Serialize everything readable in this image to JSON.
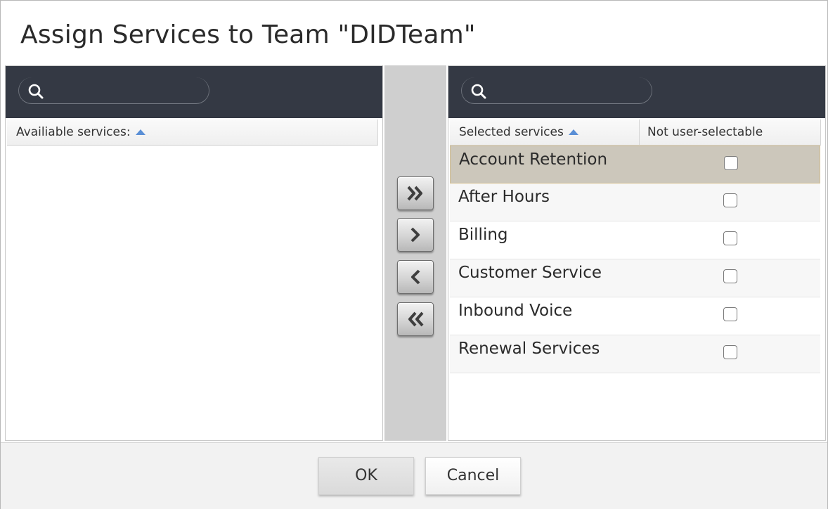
{
  "dialog": {
    "title": "Assign Services to Team \"DIDTeam\""
  },
  "available": {
    "search_placeholder": "",
    "column_header": "Availiable services:",
    "items": []
  },
  "selected": {
    "search_placeholder": "",
    "column_header": "Selected services",
    "column_header_2": "Not user-selectable",
    "items": [
      {
        "label": "Account Retention",
        "not_user_selectable": false,
        "highlighted": true
      },
      {
        "label": "After Hours",
        "not_user_selectable": false,
        "highlighted": false
      },
      {
        "label": "Billing",
        "not_user_selectable": false,
        "highlighted": false
      },
      {
        "label": "Customer Service",
        "not_user_selectable": false,
        "highlighted": false
      },
      {
        "label": "Inbound Voice",
        "not_user_selectable": false,
        "highlighted": false
      },
      {
        "label": "Renewal Services",
        "not_user_selectable": false,
        "highlighted": false
      }
    ]
  },
  "transfer_buttons": [
    {
      "name": "add-all-button",
      "icon": "double-chevron-right-icon"
    },
    {
      "name": "add-selected-button",
      "icon": "chevron-right-icon"
    },
    {
      "name": "remove-selected-button",
      "icon": "chevron-left-icon"
    },
    {
      "name": "remove-all-button",
      "icon": "double-chevron-left-icon"
    }
  ],
  "footer": {
    "ok_label": "OK",
    "cancel_label": "Cancel"
  },
  "colors": {
    "search_bar_bg": "#343944",
    "selected_row_bg": "#ccc7bb",
    "sort_arrow": "#5a8fd6",
    "transfer_strip_bg": "#cfcfcf"
  }
}
